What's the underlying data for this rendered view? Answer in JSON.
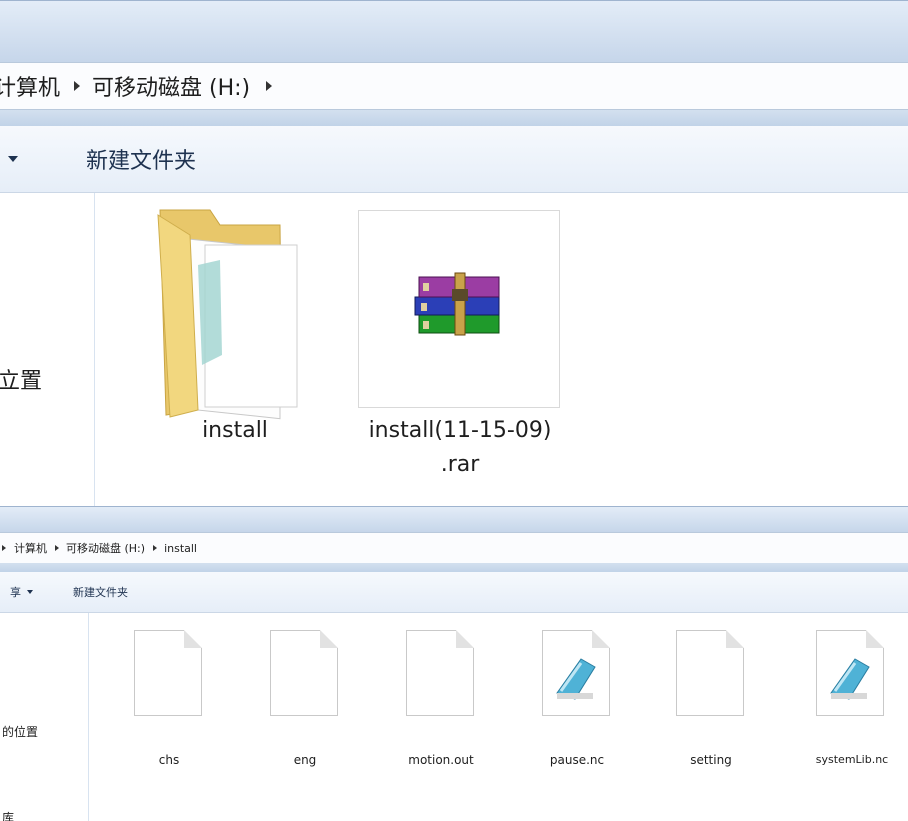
{
  "explorer_top": {
    "breadcrumb": [
      "计算机",
      "可移动磁盘 (H:)"
    ],
    "toolbar": {
      "new_folder": "新建文件夹"
    },
    "nav_partial_label": "立置",
    "items": [
      {
        "name": "install",
        "type": "folder",
        "icon": "folder-icon"
      },
      {
        "name_line1": "install(11-15-09)",
        "name_line2": ".rar",
        "type": "archive",
        "icon": "winrar-archive-icon",
        "selected": true
      }
    ]
  },
  "explorer_bottom": {
    "breadcrumb": [
      "计算机",
      "可移动磁盘 (H:)",
      "install"
    ],
    "toolbar": {
      "share_label": "享",
      "new_folder": "新建文件夹"
    },
    "nav_labels": [
      "的位置",
      "库"
    ],
    "files": [
      {
        "name": "chs",
        "icon": "blank-file-icon"
      },
      {
        "name": "eng",
        "icon": "blank-file-icon"
      },
      {
        "name": "motion.out",
        "icon": "blank-file-icon"
      },
      {
        "name": "pause.nc",
        "icon": "notepad-file-icon"
      },
      {
        "name": "setting",
        "icon": "blank-file-icon"
      },
      {
        "name": "systemLib.nc",
        "icon": "notepad-file-icon"
      }
    ]
  },
  "colors": {
    "titlebar": "#c6d6ea",
    "toolbar": "#e6eef8",
    "text": "#1e1e1e",
    "selection_border": "#d9d9d9"
  }
}
